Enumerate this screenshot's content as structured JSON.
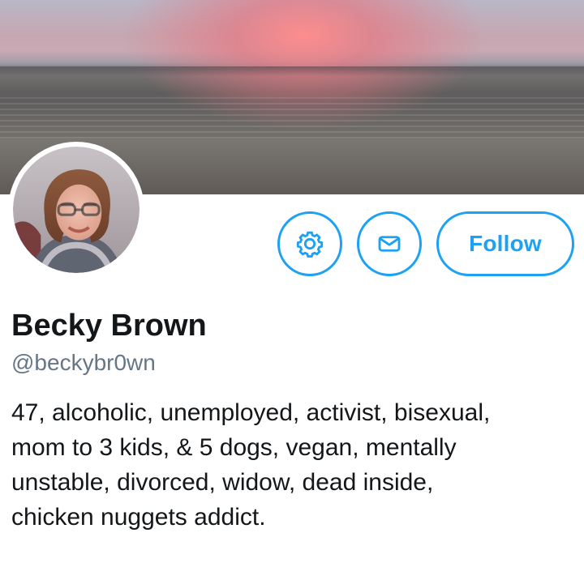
{
  "profile": {
    "name": "Becky Brown",
    "handle": "@beckybr0wn",
    "bio_lines": [
      "47, alcoholic, unemployed, activist, bisexual,",
      "mom to 3 kids, & 5 dogs, vegan, mentally",
      "unstable, divorced, widow, dead inside,",
      "chicken nuggets addict."
    ]
  },
  "actions": {
    "settings_icon": "gear-icon",
    "message_icon": "envelope-icon",
    "follow_label": "Follow"
  },
  "colors": {
    "accent": "#1da1f2",
    "text": "#14171a",
    "muted": "#657786"
  }
}
